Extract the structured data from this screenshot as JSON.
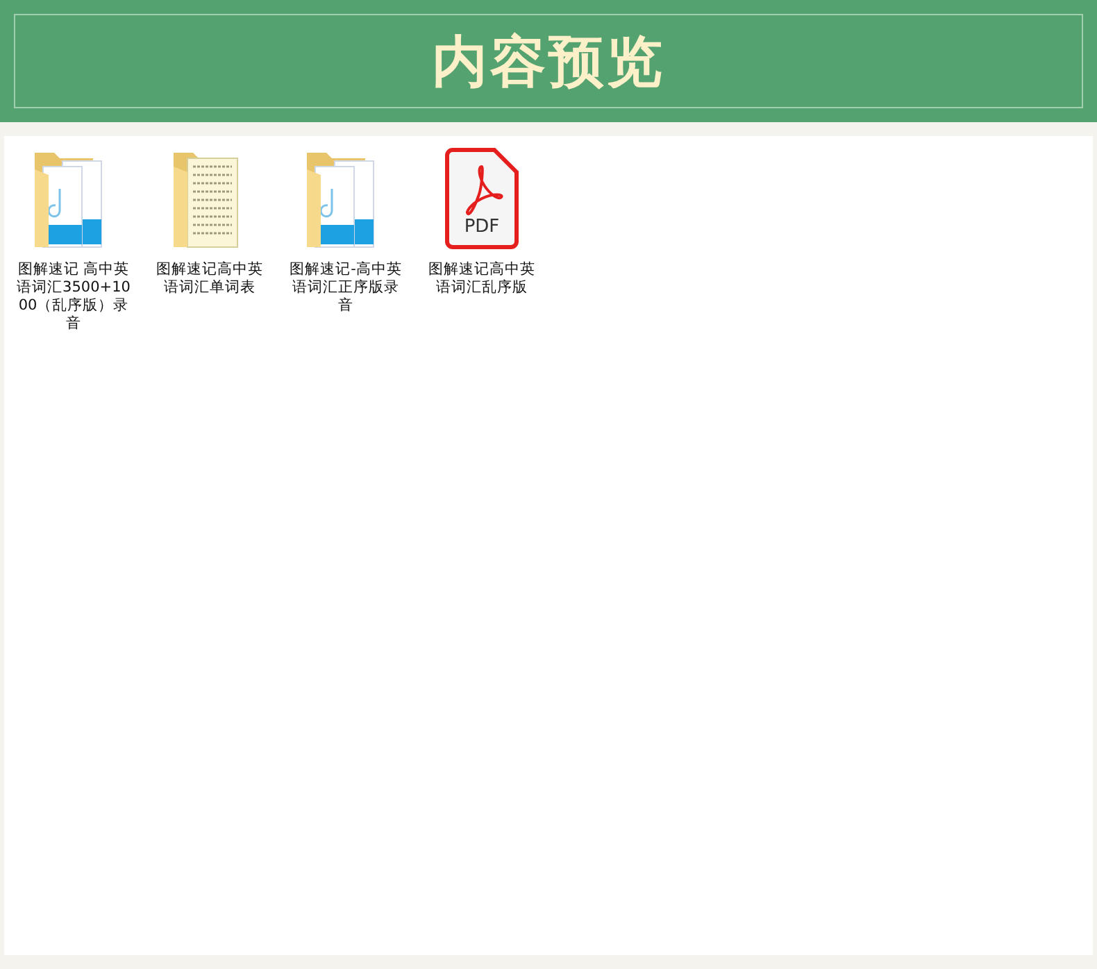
{
  "header": {
    "title": "内容预览"
  },
  "files": [
    {
      "name": "图解速记 高中英语词汇3500+1000（乱序版）录音",
      "kind": "audio-folder"
    },
    {
      "name": "图解速记高中英语词汇单词表",
      "kind": "document-folder"
    },
    {
      "name": "图解速记-高中英语词汇正序版录音",
      "kind": "audio-folder"
    },
    {
      "name": "图解速记高中英语词汇乱序版",
      "kind": "pdf",
      "icon_text": "PDF"
    }
  ]
}
